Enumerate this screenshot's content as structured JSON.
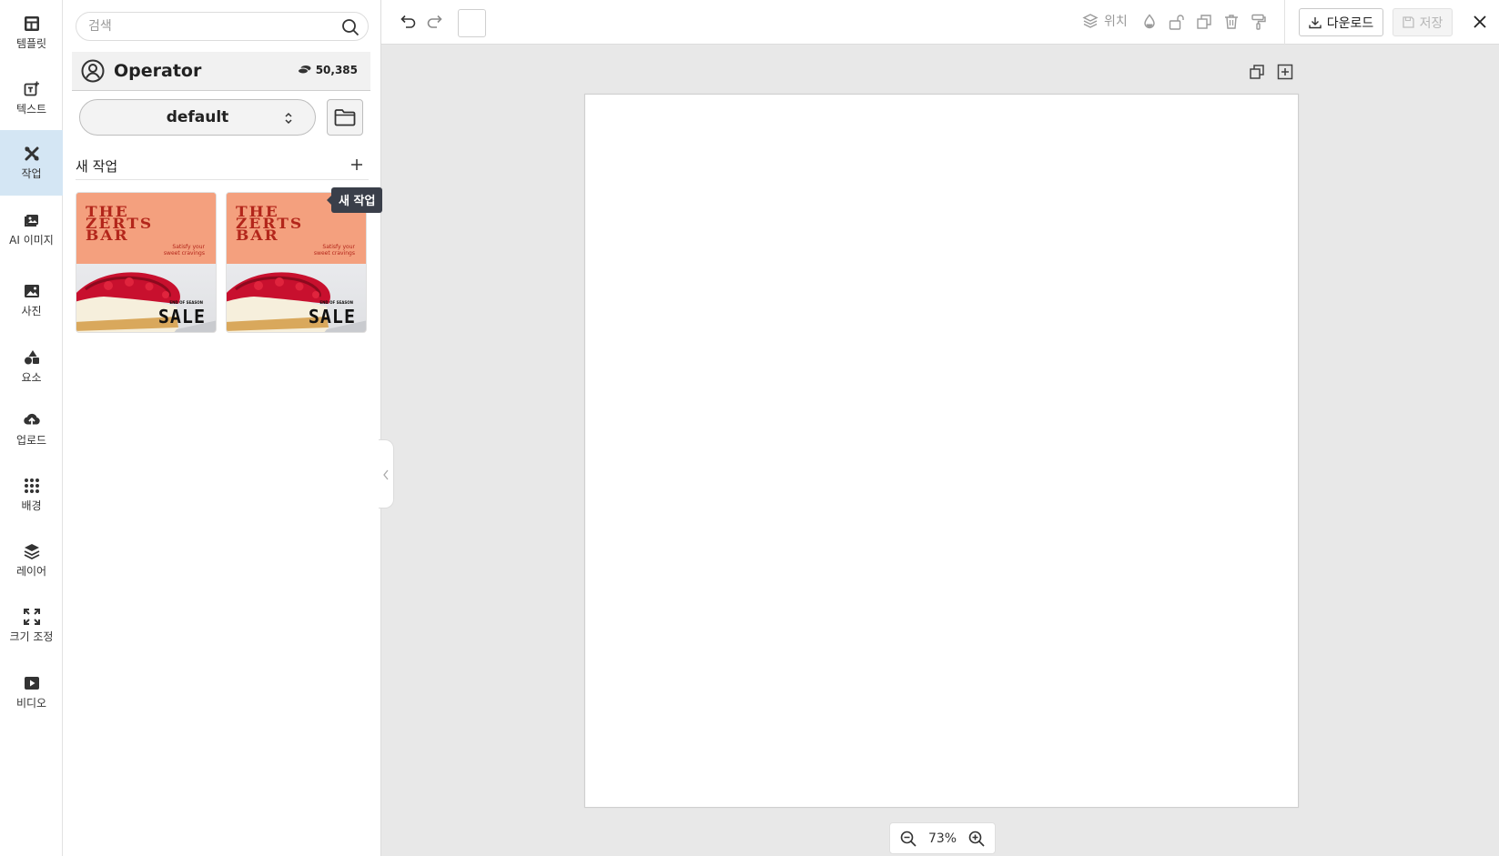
{
  "sidebar": {
    "items": [
      {
        "label": "템플릿",
        "icon": "template-icon"
      },
      {
        "label": "텍스트",
        "icon": "text-icon"
      },
      {
        "label": "작업",
        "icon": "tools-icon",
        "active": true
      },
      {
        "label": "AI 이미지",
        "icon": "ai-image-icon"
      },
      {
        "label": "사진",
        "icon": "photo-icon"
      },
      {
        "label": "요소",
        "icon": "shapes-icon"
      },
      {
        "label": "업로드",
        "icon": "upload-icon"
      },
      {
        "label": "배경",
        "icon": "background-grid-icon"
      },
      {
        "label": "레이어",
        "icon": "layers-icon"
      },
      {
        "label": "크기 조정",
        "icon": "resize-icon"
      },
      {
        "label": "비디오",
        "icon": "video-icon"
      }
    ]
  },
  "panel": {
    "search": {
      "placeholder": "검색",
      "value": ""
    },
    "user": {
      "name": "Operator",
      "credits": "50,385"
    },
    "workspace": {
      "selected": "default"
    },
    "section_title": "새 작업",
    "tooltip": "새 작업",
    "thumbnails": [
      {
        "headline_line1": "THE",
        "headline_line2": "ZERTS",
        "headline_line3": "BAR",
        "tagline_1": "Satisfy your",
        "tagline_2": "sweet cravings",
        "sub": "END OF SEASON",
        "sale": "SALE"
      },
      {
        "headline_line1": "THE",
        "headline_line2": "ZERTS",
        "headline_line3": "BAR",
        "tagline_1": "Satisfy your",
        "tagline_2": "sweet cravings",
        "sub": "END OF SEASON",
        "sale": "SALE"
      }
    ]
  },
  "toolbar": {
    "position_label": "위치",
    "download_label": "다운로드",
    "save_label": "저장"
  },
  "zoom": {
    "level": "73%"
  },
  "colors": {
    "accent_active": "#d4e6f4",
    "canvas_bg": "#e8e8e8",
    "thumb_bg": "#f4a07e",
    "thumb_text": "#b3261b"
  }
}
